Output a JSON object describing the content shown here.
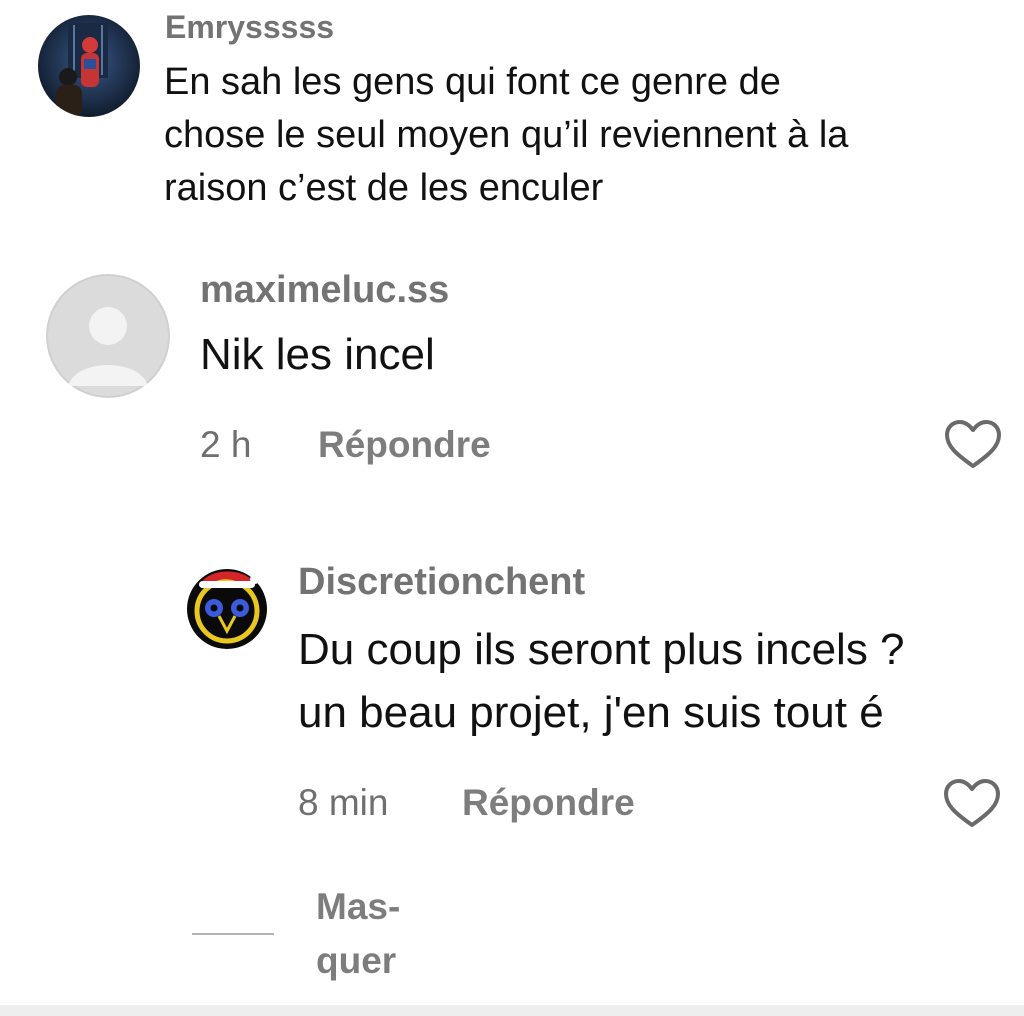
{
  "comments": [
    {
      "username": "Emrysssss",
      "lines": [
        "En sah les gens qui font ce genre de",
        "chose le seul moyen qu’il reviennent à la",
        "raison c’est de les enculer"
      ],
      "avatar_icon": "spider-man-avatar-icon"
    },
    {
      "username": "maximeluc.ss",
      "lines": [
        "Nik les incel"
      ],
      "time": "2 h",
      "reply_label": "Répondre",
      "avatar_icon": "default-user-avatar-icon",
      "like_icon": "heart-icon"
    },
    {
      "username": "Discretionchent",
      "lines": [
        "Du coup ils seront plus incels ?",
        "un beau projet, j'en suis tout é"
      ],
      "time": "8 min",
      "reply_label": "Répondre",
      "avatar_icon": "owl-christmas-hat-avatar-icon",
      "like_icon": "heart-icon"
    }
  ],
  "hide_replies": {
    "lines": [
      "Mas-",
      "quer"
    ]
  },
  "colors": {
    "username": "#737373",
    "text": "#111111",
    "meta": "#6f6f6f",
    "icon": "#6a6a6a"
  }
}
